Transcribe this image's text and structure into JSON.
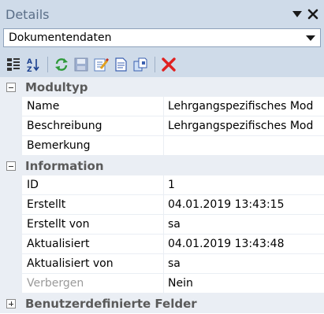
{
  "window": {
    "title": "Details"
  },
  "dropdown": {
    "selected": "Dokumentendaten"
  },
  "toolbar": {
    "icons": [
      "categorized-icon",
      "sort-az-icon",
      "refresh-icon",
      "save-icon",
      "edit-icon",
      "document-icon",
      "copy-icon",
      "delete-icon"
    ]
  },
  "categories": [
    {
      "label": "Modultyp",
      "expanded": true,
      "rows": [
        {
          "name": "Name",
          "value": "Lehrgangspezifisches Mod"
        },
        {
          "name": "Beschreibung",
          "value": "Lehrgangspezifisches Mod"
        },
        {
          "name": "Bemerkung",
          "value": ""
        }
      ]
    },
    {
      "label": "Information",
      "expanded": true,
      "rows": [
        {
          "name": "ID",
          "value": "1"
        },
        {
          "name": "Erstellt",
          "value": "04.01.2019 13:43:15"
        },
        {
          "name": "Erstellt von",
          "value": "sa"
        },
        {
          "name": "Aktualisiert",
          "value": "04.01.2019 13:43:48"
        },
        {
          "name": "Aktualisiert von",
          "value": "sa"
        },
        {
          "name": "Verbergen",
          "value": "Nein"
        }
      ]
    },
    {
      "label": "Benutzerdefinierte Felder",
      "expanded": false,
      "rows": []
    }
  ],
  "colors": {
    "header_bg": "#cfdbe9",
    "category_bg": "#eaeef4",
    "delete_red": "#e02020"
  }
}
